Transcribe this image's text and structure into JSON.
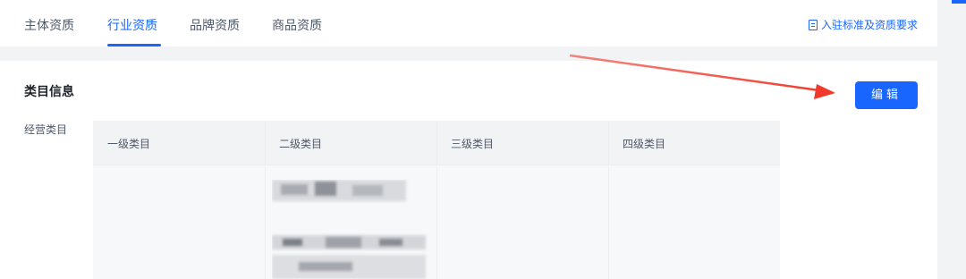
{
  "tabs": [
    {
      "label": "主体资质",
      "active": false
    },
    {
      "label": "行业资质",
      "active": true
    },
    {
      "label": "品牌资质",
      "active": false
    },
    {
      "label": "商品资质",
      "active": false
    }
  ],
  "requirements_link": "入驻标准及资质要求",
  "section": {
    "title": "类目信息",
    "edit_button": "编辑",
    "field_label": "经营类目"
  },
  "table": {
    "headers": [
      "一级类目",
      "二级类目",
      "三级类目",
      "四级类目"
    ]
  },
  "colors": {
    "accent": "#1966ff",
    "annotation_arrow": "#f0392b"
  }
}
